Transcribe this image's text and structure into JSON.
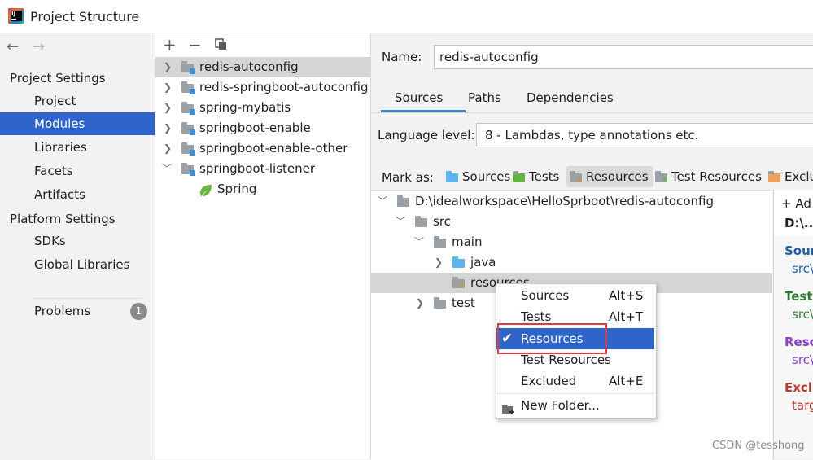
{
  "window": {
    "title": "Project Structure"
  },
  "left_nav": {
    "back_icon": "arrow-left-icon",
    "forward_icon": "arrow-right-icon",
    "project_settings_header": "Project Settings",
    "project_settings_items": [
      {
        "label": "Project"
      },
      {
        "label": "Modules",
        "selected": true
      },
      {
        "label": "Libraries"
      },
      {
        "label": "Facets"
      },
      {
        "label": "Artifacts"
      }
    ],
    "platform_settings_header": "Platform Settings",
    "platform_settings_items": [
      {
        "label": "SDKs"
      },
      {
        "label": "Global Libraries"
      }
    ],
    "problems": {
      "label": "Problems",
      "count": "1"
    }
  },
  "modules_panel": {
    "toolbar": {
      "add": "+",
      "remove": "−",
      "copy_icon": "copy-icon"
    },
    "modules": [
      {
        "label": "redis-autoconfig",
        "selected": true
      },
      {
        "label": "redis-springboot-autoconfig"
      },
      {
        "label": "spring-mybatis"
      },
      {
        "label": "springboot-enable"
      },
      {
        "label": "springboot-enable-other"
      },
      {
        "label": "springboot-listener",
        "expanded": true
      }
    ],
    "facet_child": {
      "label": "Spring",
      "icon": "spring-leaf-icon"
    }
  },
  "detail": {
    "name_label": "Name:",
    "name_value": "redis-autoconfig",
    "tabs": [
      {
        "label": "Sources",
        "active": true
      },
      {
        "label": "Paths"
      },
      {
        "label": "Dependencies"
      }
    ],
    "language_level_label": "Language level:",
    "language_level_value": "8 - Lambdas, type annotations etc.",
    "mark_as_label": "Mark as:",
    "mark_as_buttons": [
      {
        "label": "Sources"
      },
      {
        "label": "Tests"
      },
      {
        "label": "Resources",
        "active": true
      },
      {
        "label": "Test Resources"
      },
      {
        "label": "Exclu"
      }
    ],
    "content_tree": [
      {
        "label": "D:\\idealworkspace\\HelloSprboot\\redis-autoconfig"
      },
      {
        "label": "src"
      },
      {
        "label": "main"
      },
      {
        "label": "java"
      },
      {
        "label": "resources",
        "selected": true
      },
      {
        "label": "test"
      }
    ],
    "roots": {
      "add_label": "+ Ad",
      "root_path": "D:\\...",
      "sections": [
        {
          "title": "Sour",
          "path": "src\\",
          "color": "#1a5fa8"
        },
        {
          "title": "Test",
          "path": "src\\",
          "color": "#2e7d32"
        },
        {
          "title": "Reso",
          "path": "src\\",
          "color": "#8a3fcf"
        },
        {
          "title": "Exclu",
          "path": "targ",
          "color": "#c0392b"
        }
      ]
    }
  },
  "context_menu": {
    "items": [
      {
        "label": "Sources",
        "shortcut": "Alt+S"
      },
      {
        "label": "Tests",
        "shortcut": "Alt+T"
      },
      {
        "label": "Resources",
        "shortcut": "",
        "checked": true,
        "selected": true
      },
      {
        "label": "Test Resources",
        "shortcut": ""
      },
      {
        "label": "Excluded",
        "shortcut": "Alt+E"
      }
    ],
    "new_folder": "New Folder..."
  },
  "watermark": "CSDN @tesshong",
  "colors": {
    "selection": "#2f65ca",
    "highlight_box": "#e23a3a",
    "source_folder": "#5eb4ef"
  }
}
